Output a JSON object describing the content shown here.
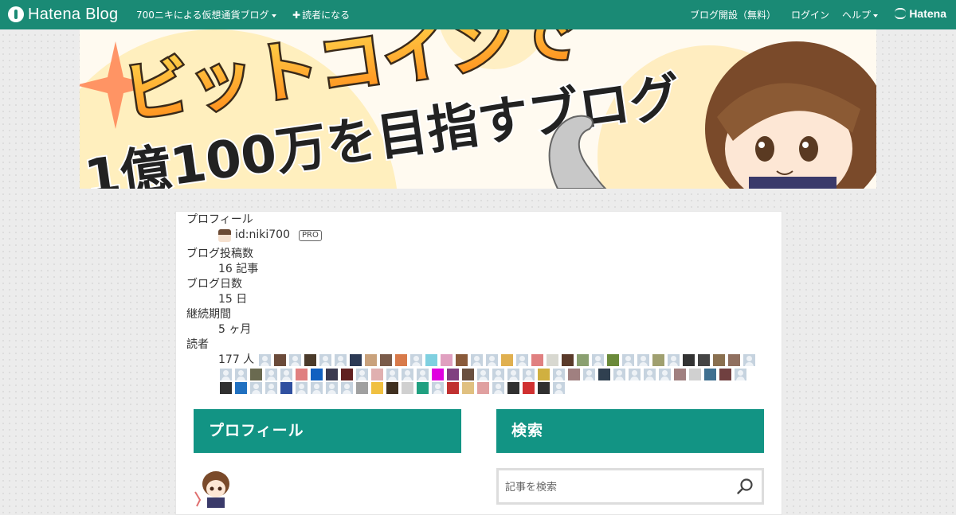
{
  "topbar": {
    "logo_text": "Hatena Blog",
    "blog_menu": "700ニキによる仮想通貨ブログ",
    "subscribe": "読者になる",
    "start_blog": "ブログ開設（無料）",
    "login": "ログイン",
    "help": "ヘルプ",
    "hatena": "Hatena",
    "color": "#1a8a75"
  },
  "banner": {
    "line1": "ビットコインで",
    "line2": "1億100万を目指すブログ"
  },
  "profile_stats": {
    "heading": "プロフィール",
    "user_id": "id:niki700",
    "pro_label": "PRO",
    "posts_label": "ブログ投稿数",
    "posts_value": "16 記事",
    "days_label": "ブログ日数",
    "days_value": "15 日",
    "period_label": "継続期間",
    "period_value": "5 ヶ月",
    "readers_label": "読者",
    "readers_value": "177 人"
  },
  "reader_avatars": [
    "#c6d3df",
    "#6b4b3a",
    "#c6d3df",
    "#4a3a2a",
    "#c6d3df",
    "#c6d3df",
    "#2c3a55",
    "#c9a27c",
    "#7a5c4a",
    "#d87a4a",
    "#c6d3df",
    "#7fd0e0",
    "#e0a0c0",
    "#8a5a3a",
    "#c6d3df",
    "#c6d3df",
    "#e0b050",
    "#c6d3df",
    "#e08080",
    "#d8d8d0",
    "#5a3a2a",
    "#8aa070",
    "#c6d3df",
    "#6a8a3a",
    "#c6d3df",
    "#c6d3df",
    "#a0a070",
    "#c6d3df",
    "#333333",
    "#444444",
    "#8a7050",
    "#907060",
    "#c6d3df",
    "#c6d3df",
    "#c6d3df",
    "#6a6a50",
    "#c6d3df",
    "#c6d3df",
    "#e08080",
    "#1060c0",
    "#3a3a50",
    "#602020",
    "#c6d3df",
    "#e0b0b0",
    "#c6d3df",
    "#c6d3df",
    "#c6d3df",
    "#e000e0",
    "#804080",
    "#6a5040",
    "#c6d3df",
    "#c6d3df",
    "#c6d3df",
    "#c6d3df",
    "#d0b040",
    "#c6d3df",
    "#a08080",
    "#c6d3df",
    "#304050",
    "#c6d3df",
    "#c6d3df",
    "#c6d3df",
    "#c6d3df",
    "#a08080",
    "#d0d0d0",
    "#407090",
    "#704040",
    "#c6d3df",
    "#303030",
    "#2070c0",
    "#c6d3df",
    "#c6d3df",
    "#3050a0",
    "#c6d3df",
    "#c6d3df",
    "#c6d3df",
    "#c6d3df",
    "#a0a0a0",
    "#f0c040",
    "#403020",
    "#d0d0d0",
    "#20a080",
    "#c6d3df",
    "#c03030",
    "#e0c080",
    "#e0a0a0",
    "#c6d3df",
    "#303030",
    "#d03030",
    "#303030",
    "#c6d3df"
  ],
  "modules": {
    "profile_title": "プロフィール",
    "search_title": "検索",
    "search_placeholder": "記事を検索"
  }
}
